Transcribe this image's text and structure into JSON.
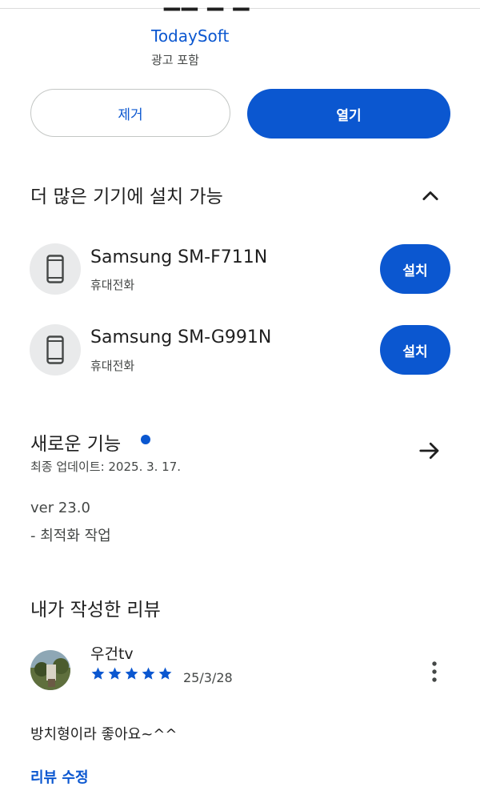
{
  "header": {
    "developer": "TodaySoft",
    "ad_note": "광고 포함"
  },
  "actions": {
    "remove_label": "제거",
    "open_label": "열기"
  },
  "more_devices": {
    "title": "더 많은 기기에 설치 가능",
    "devices": [
      {
        "name": "Samsung SM-F711N",
        "type": "휴대전화",
        "install_label": "설치"
      },
      {
        "name": "Samsung SM-G991N",
        "type": "휴대전화",
        "install_label": "설치"
      }
    ]
  },
  "whats_new": {
    "title": "새로운 기능",
    "updated": "최종 업데이트: 2025. 3. 17.",
    "version": "ver 23.0",
    "note": "- 최적화 작업"
  },
  "my_review": {
    "title": "내가 작성한 리뷰",
    "reviewer": "우건tv",
    "rating": 5,
    "date": "25/3/28",
    "text": "방치형이라 좋아요~^^",
    "edit_label": "리뷰 수정"
  },
  "icons": {
    "collapse": "chevron-up-icon",
    "device": "phone-icon",
    "forward": "arrow-right-icon",
    "star": "star-icon",
    "more": "more-vert-icon",
    "new_dot": "dot-indicator-icon"
  },
  "colors": {
    "accent": "#0b57d0",
    "text": "#1f1f1f",
    "secondary": "#444746",
    "chip_bg": "#e9eaeb"
  }
}
